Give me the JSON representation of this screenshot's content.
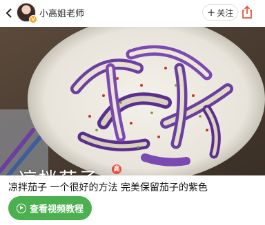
{
  "header": {
    "back_icon": "chevron-left-icon",
    "author_name": "小高姐老师",
    "avatar_badge": "V",
    "follow_icon": "plus",
    "follow_label": "关注",
    "share_icon": "share-icon"
  },
  "cover": {
    "dish_name": "凉拌茄子",
    "seal_text": "高"
  },
  "recipe": {
    "subtitle": "凉拌茄子 一个很好的方法  完美保留茄子的紫色",
    "video_button_label": "查看视频教程"
  },
  "colors": {
    "accent_green": "#4caf50",
    "share_red": "#e8533f",
    "eggplant_purple": "#6a3fa0"
  }
}
